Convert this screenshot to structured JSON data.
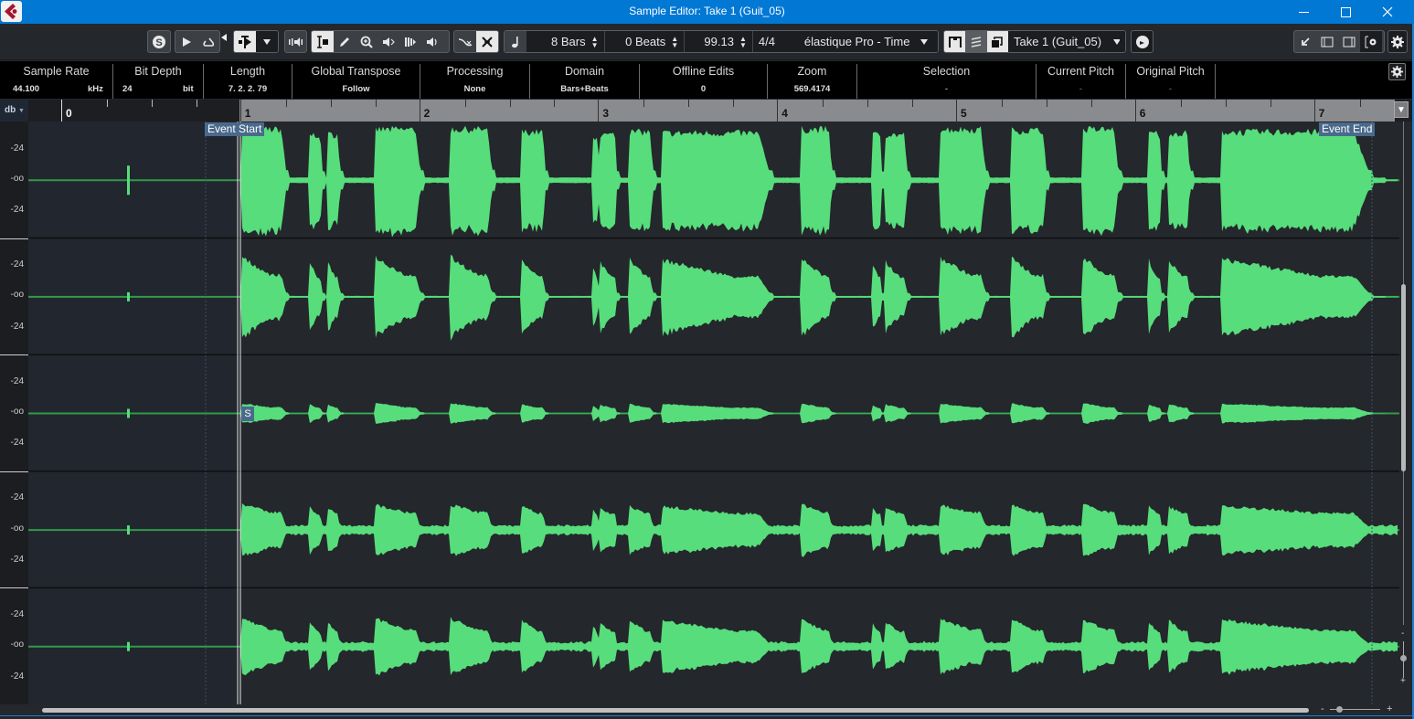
{
  "window": {
    "title": "Sample Editor: Take 1 (Guit_05)",
    "controls": [
      "minimize",
      "maximize",
      "close"
    ]
  },
  "toolbar": {
    "solo_icon": "solo-s-icon",
    "play_icon": "play-icon",
    "loop_icon": "loop-icon",
    "length_value": "8 Bars",
    "beats_value": "0 Beats",
    "tempo_value": "99.13",
    "signature_value": "4/4",
    "algorithm_value": "élastique Pro - Time",
    "take_value": "Take 1 (Guit_05)"
  },
  "infoline": {
    "columns": [
      {
        "label": "Sample Rate",
        "value": "44.100",
        "unit": "kHz"
      },
      {
        "label": "Bit Depth",
        "value": "24",
        "unit": "bit"
      },
      {
        "label": "Length",
        "value": "7. 2. 2. 79"
      },
      {
        "label": "Global Transpose",
        "value": "Follow"
      },
      {
        "label": "Processing",
        "value": "None"
      },
      {
        "label": "Domain",
        "value": "Bars+Beats"
      },
      {
        "label": "Offline Edits",
        "value": "0"
      },
      {
        "label": "Zoom",
        "value": "569.4174"
      },
      {
        "label": "Selection",
        "value": "-"
      },
      {
        "label": "Current Pitch",
        "value": "-"
      },
      {
        "label": "Original Pitch",
        "value": "-"
      }
    ]
  },
  "ruler": {
    "scale_label": "db",
    "bars": [
      "0",
      "1",
      "2",
      "3",
      "4",
      "5",
      "6",
      "7"
    ]
  },
  "markers": {
    "event_start": "Event Start",
    "event_end": "Event End",
    "snap": "S"
  },
  "db_scale": {
    "labels": [
      "-24",
      "-oo",
      "-24"
    ]
  },
  "waveform": {
    "channels": 5,
    "color": "#57dd7b",
    "baseline_color": "#2f9c48",
    "event_start_bar": 1,
    "event_end_bar": 7.4,
    "notes": [
      {
        "start": 1.0,
        "end": 1.25,
        "amp": 0.95
      },
      {
        "start": 1.38,
        "end": 1.45,
        "amp": 0.85
      },
      {
        "start": 1.48,
        "end": 1.55,
        "amp": 0.85
      },
      {
        "start": 1.75,
        "end": 2.0,
        "amp": 0.95
      },
      {
        "start": 2.17,
        "end": 2.4,
        "amp": 0.95
      },
      {
        "start": 2.56,
        "end": 2.7,
        "amp": 0.9
      },
      {
        "start": 2.96,
        "end": 3.0,
        "amp": 0.8
      },
      {
        "start": 3.0,
        "end": 3.1,
        "amp": 0.85
      },
      {
        "start": 3.17,
        "end": 3.3,
        "amp": 0.9
      },
      {
        "start": 3.35,
        "end": 3.95,
        "amp": 0.88
      },
      {
        "start": 4.13,
        "end": 4.3,
        "amp": 0.95
      },
      {
        "start": 4.52,
        "end": 4.58,
        "amp": 0.85
      },
      {
        "start": 4.6,
        "end": 4.72,
        "amp": 0.85
      },
      {
        "start": 4.9,
        "end": 5.16,
        "amp": 0.95
      },
      {
        "start": 5.3,
        "end": 5.5,
        "amp": 0.93
      },
      {
        "start": 5.7,
        "end": 5.9,
        "amp": 0.95
      },
      {
        "start": 6.07,
        "end": 6.14,
        "amp": 0.88
      },
      {
        "start": 6.18,
        "end": 6.3,
        "amp": 0.88
      },
      {
        "start": 6.48,
        "end": 7.3,
        "amp": 0.9
      }
    ]
  },
  "scrollbars": {
    "horizontal_zoom": [
      "-",
      "+"
    ],
    "vertical_zoom": [
      "-",
      "+"
    ]
  }
}
